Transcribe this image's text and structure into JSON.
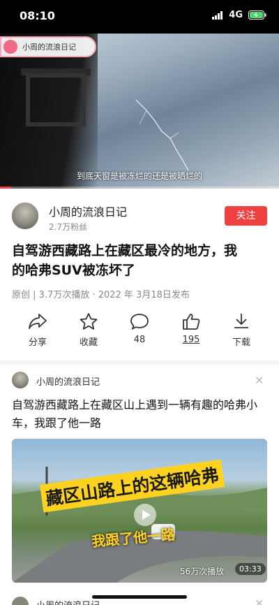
{
  "status_bar": {
    "time": "08:10",
    "network": "4G",
    "icons": [
      "signal-icon",
      "battery-charging-icon"
    ]
  },
  "video": {
    "channel_watermark": "小周的流浪日记",
    "subtitle": "到底天窗是被冻烂的还是被晒烂的",
    "progress": 0.04,
    "progress_color": "#f04142"
  },
  "author": {
    "name": "小周的流浪日记",
    "fans": "2.7万粉丝",
    "follow_label": "关注"
  },
  "article": {
    "title": "自驾游西藏路上在藏区最冷的地方，我的哈弗SUV被冻坏了",
    "meta": "原创 | 3.7万次播放 · 2022 年 3月18日发布"
  },
  "actions": [
    {
      "label": "分享",
      "icon": "share-icon"
    },
    {
      "label": "收藏",
      "icon": "star-icon"
    },
    {
      "label": "48",
      "icon": "comment-icon"
    },
    {
      "label": "195",
      "icon": "thumbs-up-icon"
    },
    {
      "label": "下载",
      "icon": "download-icon"
    }
  ],
  "related": {
    "author": "小周的流浪日记",
    "title": "自驾游西藏路上在藏区山上遇到一辆有趣的哈弗小车，我跟了他一路",
    "thumb_text1": "藏区山路上的这辆哈弗",
    "thumb_text2": "我跟了他一路",
    "views": "56万次播放",
    "duration": "03:33"
  },
  "next": {
    "author": "小周的流浪日记"
  },
  "colors": {
    "accent": "#f04142",
    "meta_gray": "#888888"
  }
}
